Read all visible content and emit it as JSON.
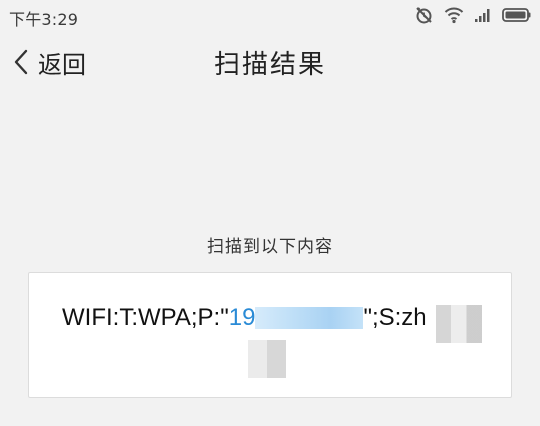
{
  "status_bar": {
    "time": "下午3:29",
    "icons": [
      "alarm-off-icon",
      "wifi-icon",
      "signal-icon",
      "battery-icon"
    ]
  },
  "header": {
    "back_label": "返回",
    "title": "扫描结果"
  },
  "content": {
    "caption": "扫描到以下内容",
    "result_prefix": "WIFI:T:WPA;P:\"",
    "password_visible": "19",
    "result_suffix": "\";S:zh"
  },
  "colors": {
    "background": "#f2f2f2",
    "card": "#ffffff",
    "accent": "#2a8bd6"
  }
}
